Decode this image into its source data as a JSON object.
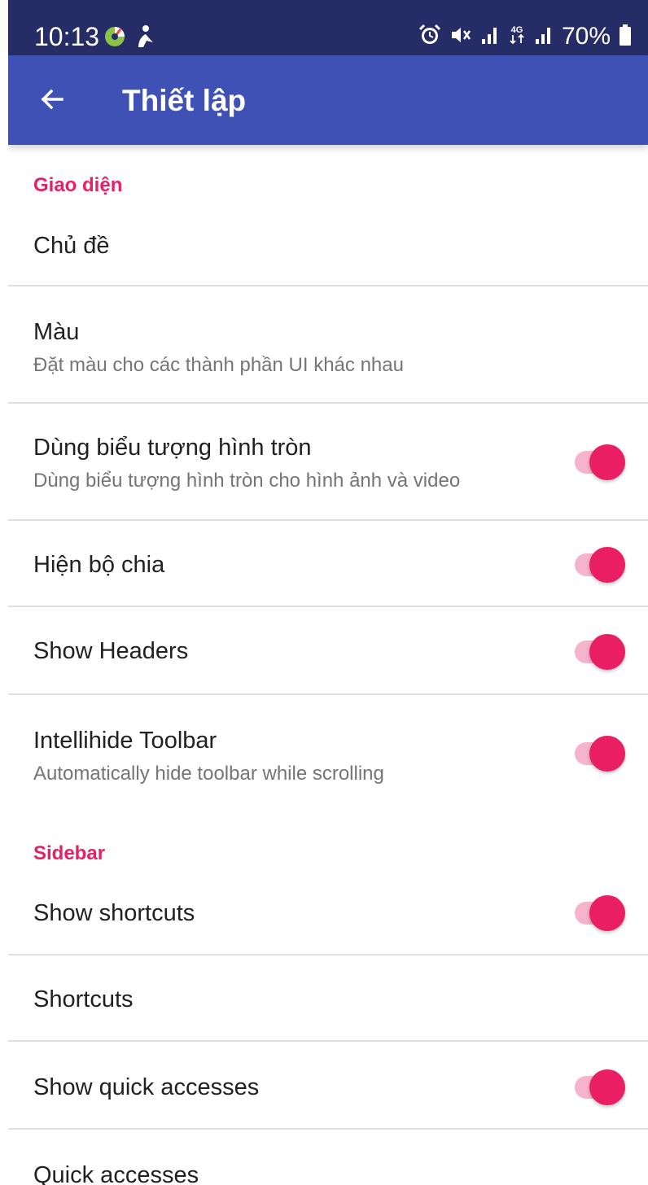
{
  "status_bar": {
    "time": "10:13",
    "battery": "70%",
    "left_icons": [
      "app-notification-icon",
      "person-icon"
    ],
    "right_icons": [
      "alarm-icon",
      "mute-icon",
      "signal-icon",
      "4g-icon",
      "signal-icon",
      "battery-icon"
    ]
  },
  "app_bar": {
    "title": "Thiết lập",
    "back_icon": "arrow-back-icon"
  },
  "sections": {
    "appearance": {
      "header": "Giao diện",
      "theme": {
        "title": "Chủ đề"
      },
      "color": {
        "title": "Màu",
        "summary": "Đặt màu cho các thành phần UI khác nhau"
      },
      "circular_icons": {
        "title": "Dùng biểu tượng hình tròn",
        "summary": "Dùng biểu tượng hình tròn cho hình ảnh và video",
        "enabled": true
      },
      "show_dividers": {
        "title": "Hiện bộ chia",
        "enabled": true
      },
      "show_headers": {
        "title": "Show Headers",
        "enabled": true
      },
      "intellihide": {
        "title": "Intellihide Toolbar",
        "summary": "Automatically hide toolbar while scrolling",
        "enabled": true
      }
    },
    "sidebar": {
      "header": "Sidebar",
      "show_shortcuts": {
        "title": "Show shortcuts",
        "enabled": true
      },
      "shortcuts": {
        "title": "Shortcuts"
      },
      "show_quick_accesses": {
        "title": "Show quick accesses",
        "enabled": true
      },
      "quick_accesses": {
        "title": "Quick accesses"
      }
    }
  },
  "colors": {
    "status_bar": "#262d66",
    "app_bar": "#3f51b5",
    "accent": "#e91e63",
    "switch_track": "#f5b3cc",
    "divider": "#e0e0e0"
  }
}
